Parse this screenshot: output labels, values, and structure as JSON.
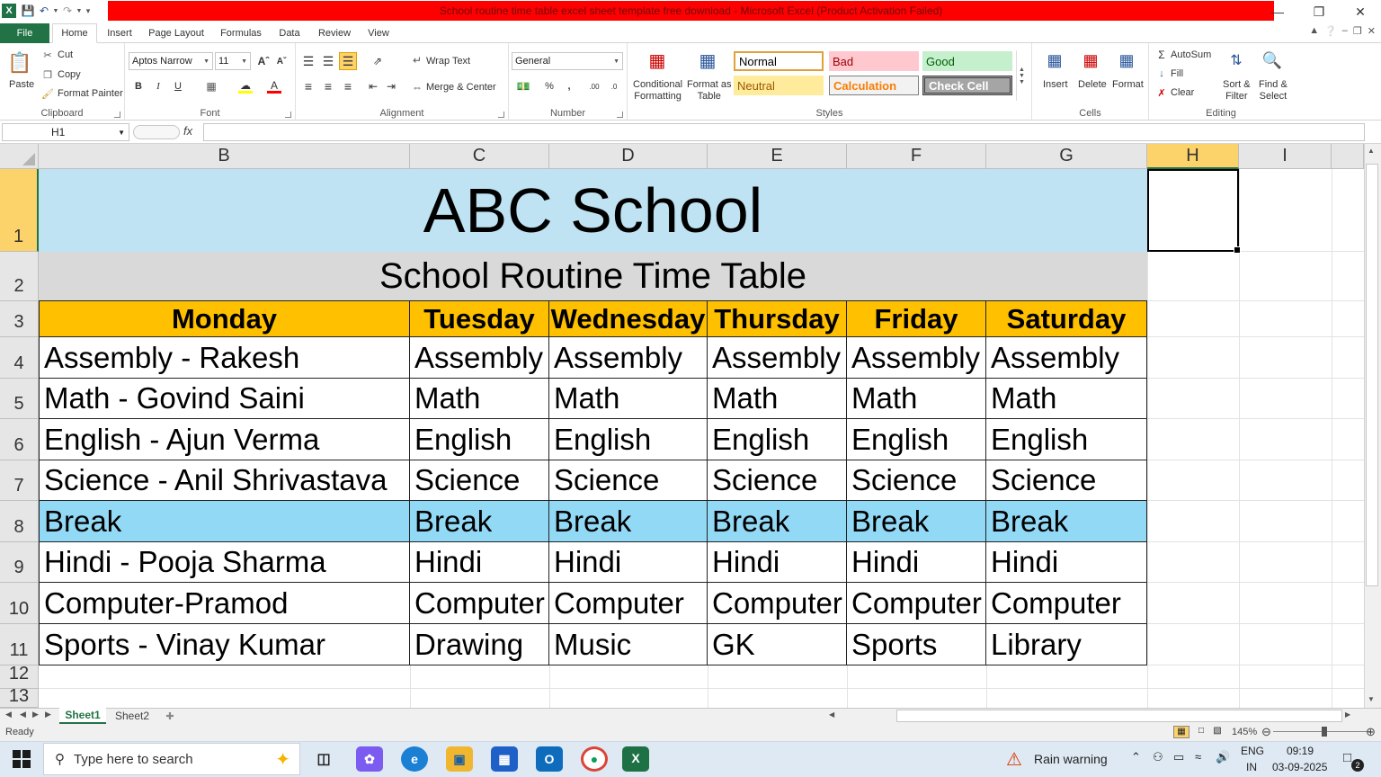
{
  "window": {
    "title": "School routine time table excel sheet template free download  -  Microsoft Excel (Product Activation Failed)"
  },
  "ribbon": {
    "tabs": [
      "File",
      "Home",
      "Insert",
      "Page Layout",
      "Formulas",
      "Data",
      "Review",
      "View"
    ],
    "clipboard": {
      "paste": "Paste",
      "cut": "Cut",
      "copy": "Copy",
      "format_painter": "Format Painter",
      "label": "Clipboard"
    },
    "font": {
      "name": "Aptos Narrow",
      "size": "11",
      "label": "Font"
    },
    "alignment": {
      "wrap_text": "Wrap Text",
      "merge_center": "Merge & Center",
      "label": "Alignment"
    },
    "number": {
      "format": "General",
      "label": "Number"
    },
    "styles": {
      "conditional": "Conditional\nFormatting",
      "format_table": "Format as\nTable",
      "normal": "Normal",
      "bad": "Bad",
      "good": "Good",
      "neutral": "Neutral",
      "calculation": "Calculation",
      "check_cell": "Check Cell",
      "label": "Styles"
    },
    "cells": {
      "insert": "Insert",
      "delete": "Delete",
      "format": "Format",
      "label": "Cells"
    },
    "editing": {
      "autosum": "AutoSum",
      "fill": "Fill",
      "clear": "Clear",
      "sort_filter": "Sort &\nFilter",
      "find_select": "Find &\nSelect",
      "label": "Editing"
    }
  },
  "formula_bar": {
    "name_box": "H1",
    "fx": "fx",
    "value": ""
  },
  "grid": {
    "columns": [
      "B",
      "C",
      "D",
      "E",
      "F",
      "G",
      "H",
      "I"
    ],
    "rows": [
      "1",
      "2",
      "3",
      "4",
      "5",
      "6",
      "7",
      "8",
      "9",
      "10",
      "11",
      "12",
      "13"
    ],
    "title": "ABC School",
    "subtitle": "School Routine Time Table",
    "days": [
      "Monday",
      "Tuesday",
      "Wednesday",
      "Thursday",
      "Friday",
      "Saturday"
    ],
    "schedule": [
      [
        "Assembly - Rakesh",
        "Assembly",
        "Assembly",
        "Assembly",
        "Assembly",
        "Assembly"
      ],
      [
        "Math - Govind Saini",
        "Math",
        "Math",
        "Math",
        "Math",
        "Math"
      ],
      [
        "English - Ajun Verma",
        "English",
        "English",
        "English",
        "English",
        "English"
      ],
      [
        "Science - Anil Shrivastava",
        "Science",
        "Science",
        "Science",
        "Science",
        "Science"
      ],
      [
        "Break",
        "Break",
        "Break",
        "Break",
        "Break",
        "Break"
      ],
      [
        "Hindi - Pooja Sharma",
        "Hindi",
        "Hindi",
        "Hindi",
        "Hindi",
        "Hindi"
      ],
      [
        "Computer-Pramod",
        "Computer",
        "Computer",
        "Computer",
        "Computer",
        "Computer"
      ],
      [
        "Sports - Vinay Kumar",
        "Drawing",
        "Music",
        "GK",
        "Sports",
        "Library"
      ]
    ],
    "colors": {
      "title_bg": "#bfe3f2",
      "subtitle_bg": "#d9d9d9",
      "day_bg": "#ffc000",
      "break_bg": "#92d9f5"
    }
  },
  "sheets": [
    "Sheet1",
    "Sheet2"
  ],
  "status": {
    "ready": "Ready",
    "zoom": "145%"
  },
  "taskbar": {
    "search_placeholder": "Type here to search",
    "weather": "Rain warning",
    "lang1": "ENG",
    "lang2": "IN",
    "time": "09:19",
    "date": "03-09-2025",
    "notifications": "2"
  }
}
